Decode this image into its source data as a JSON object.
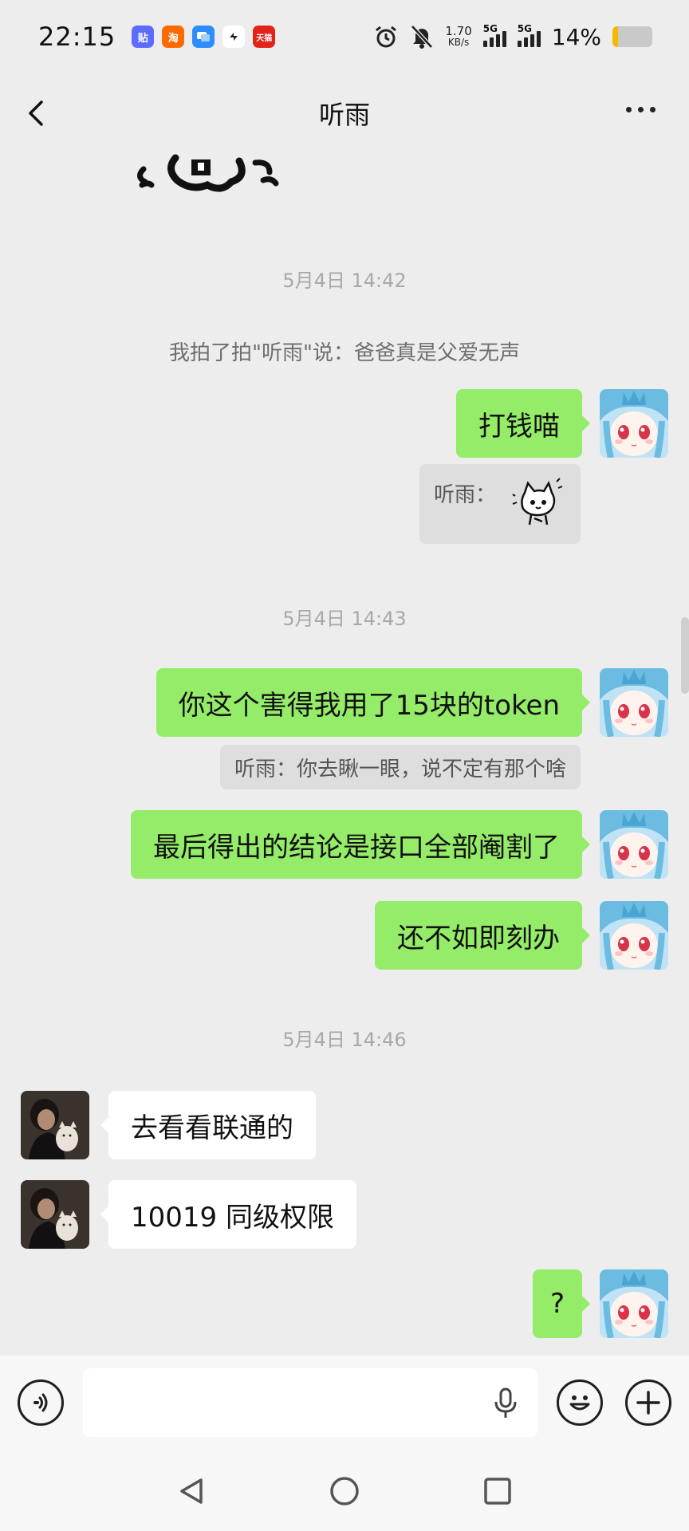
{
  "status_bar": {
    "time": "22:15",
    "net_speed_value": "1.70",
    "net_speed_unit": "KB/s",
    "signal_1": "5G",
    "signal_2": "5G",
    "battery_percent": "14%",
    "battery_level": 0.14,
    "apps": [
      {
        "label": "贴",
        "icon": "tieba-app-icon",
        "color": "#5b6cff"
      },
      {
        "label": "淘",
        "icon": "taobao-app-icon",
        "color": "#ff6a00"
      },
      {
        "label": "",
        "icon": "messages-app-icon",
        "color": "#2f8cff"
      },
      {
        "label": "",
        "icon": "link-app-icon",
        "color": "#222222"
      },
      {
        "label": "天猫",
        "icon": "tmall-app-icon",
        "color": "#e2231a"
      }
    ]
  },
  "header": {
    "title": "听雨"
  },
  "messages": {
    "ts1": "5月4日 14:42",
    "system_pat": "我拍了拍\"听雨\"说：爸爸真是父爱无声",
    "m1": "打钱喵",
    "quote1_prefix": "听雨：",
    "ts2": "5月4日 14:43",
    "m2": "你这个害得我用了15块的token",
    "quote2": "听雨：你去瞅一眼，说不定有那个啥",
    "m3": "最后得出的结论是接口全部阉割了",
    "m4": "还不如即刻办",
    "ts3": "5月4日 14:46",
    "m5": "去看看联通的",
    "m6": "10019 同级权限",
    "m7": "?"
  },
  "colors": {
    "self_bubble": "#95ec69",
    "other_bubble": "#ffffff",
    "background": "#ededed"
  }
}
